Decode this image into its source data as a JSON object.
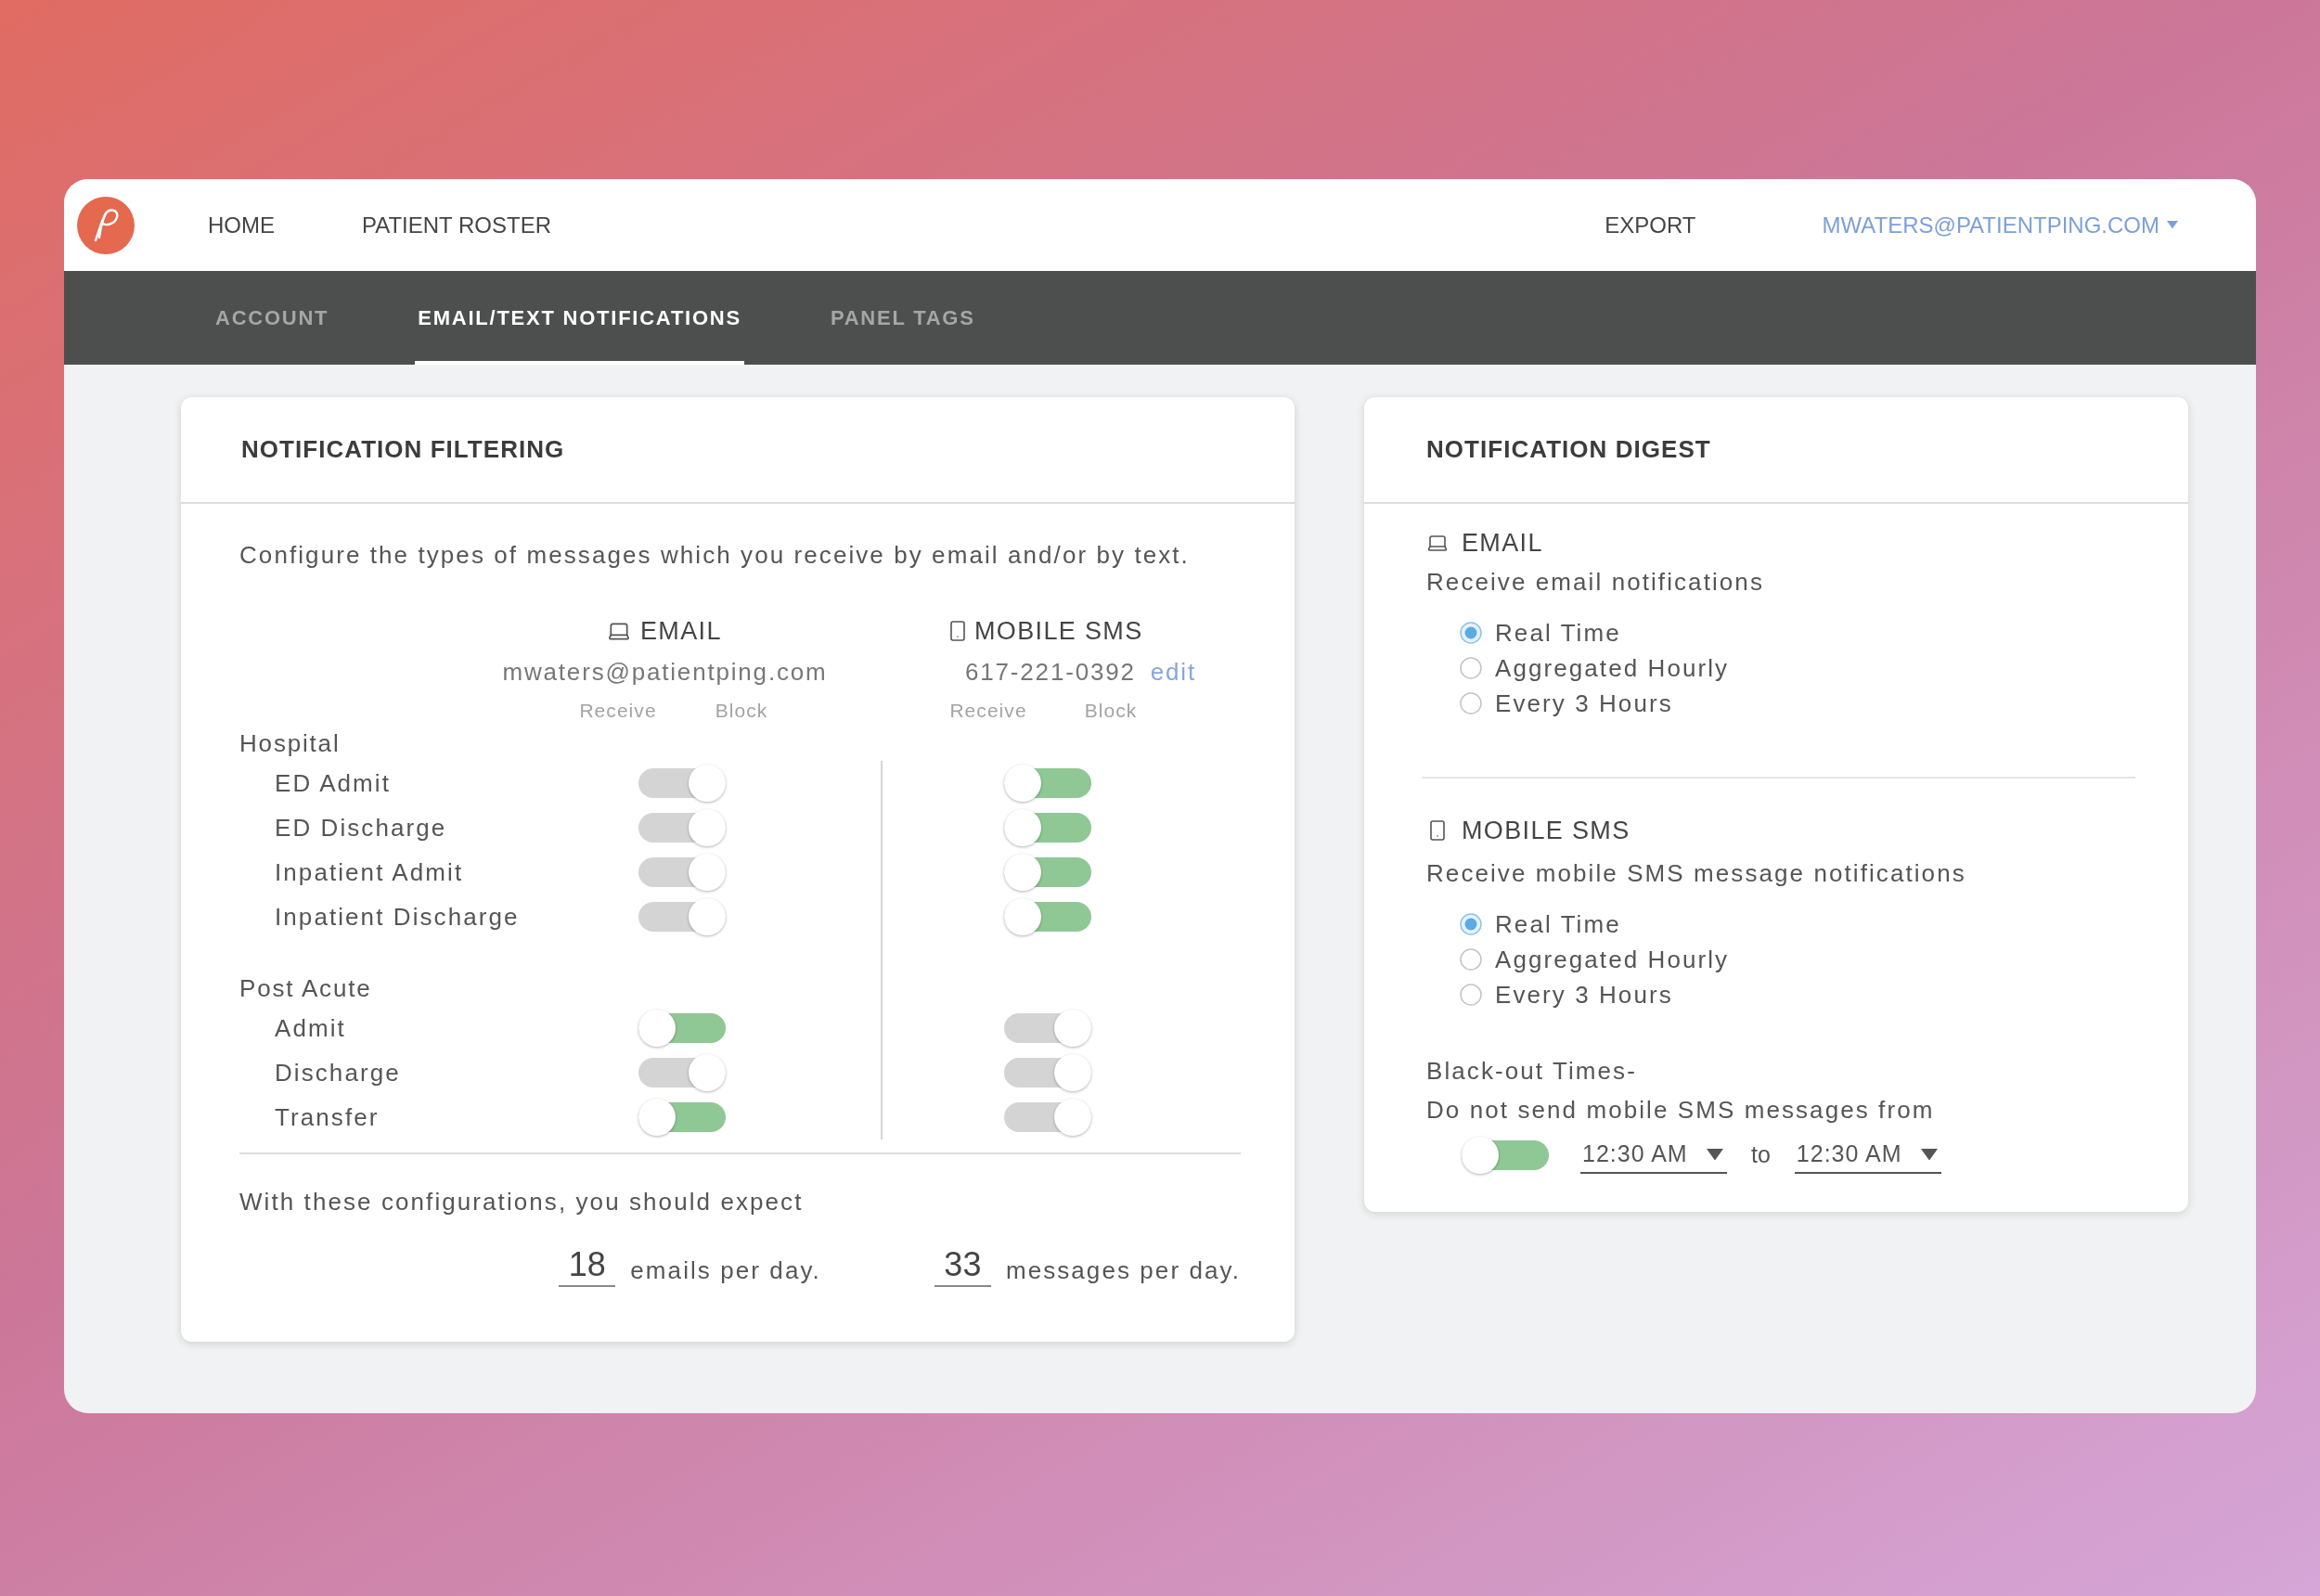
{
  "nav": {
    "links": [
      "HOME",
      "PATIENT ROSTER"
    ],
    "export": "EXPORT",
    "account": "MWATERS@PATIENTPING.COM"
  },
  "tabs": [
    {
      "label": "ACCOUNT",
      "selected": false
    },
    {
      "label": "EMAIL/TEXT NOTIFICATIONS",
      "selected": true
    },
    {
      "label": "PANEL TAGS",
      "selected": false
    }
  ],
  "filtering": {
    "title": "NOTIFICATION FILTERING",
    "description": "Configure the types of messages which you receive by email and/or by text.",
    "channels": [
      {
        "kind": "email",
        "label": "EMAIL",
        "address": "mwaters@patientping.com",
        "receive_label": "Receive",
        "block_label": "Block"
      },
      {
        "kind": "sms",
        "label": "MOBILE SMS",
        "address": "617-221-0392",
        "edit": "edit",
        "receive_label": "Receive",
        "block_label": "Block"
      }
    ],
    "groups": [
      {
        "title": "Hospital",
        "rows": [
          {
            "label": "ED Admit",
            "blocked": [
              true,
              false
            ]
          },
          {
            "label": "ED Discharge",
            "blocked": [
              true,
              false
            ]
          },
          {
            "label": "Inpatient Admit",
            "blocked": [
              true,
              false
            ]
          },
          {
            "label": "Inpatient Discharge",
            "blocked": [
              true,
              false
            ]
          }
        ]
      },
      {
        "title": "Post Acute",
        "rows": [
          {
            "label": "Admit",
            "blocked": [
              false,
              true
            ]
          },
          {
            "label": "Discharge",
            "blocked": [
              true,
              true
            ]
          },
          {
            "label": "Transfer",
            "blocked": [
              false,
              true
            ]
          }
        ]
      }
    ],
    "summary": "With these configurations, you should expect",
    "totals": [
      {
        "count": "18",
        "unit": "emails per day."
      },
      {
        "count": "33",
        "unit": "messages per day."
      }
    ]
  },
  "digest": {
    "title": "NOTIFICATION DIGEST",
    "sections": [
      {
        "kind": "email",
        "label": "EMAIL",
        "description": "Receive email notifications",
        "options": [
          {
            "label": "Real Time",
            "selected": true
          },
          {
            "label": "Aggregated Hourly",
            "selected": false
          },
          {
            "label": "Every 3 Hours",
            "selected": false
          }
        ]
      },
      {
        "kind": "sms",
        "label": "MOBILE SMS",
        "description": "Receive mobile SMS message notifications",
        "options": [
          {
            "label": "Real Time",
            "selected": true
          },
          {
            "label": "Aggregated Hourly",
            "selected": false
          },
          {
            "label": "Every 3 Hours",
            "selected": false
          }
        ]
      }
    ],
    "blackout": {
      "title": "Black-out Times-",
      "description": "Do not send mobile SMS messages from",
      "off": false,
      "from": "12:30 AM",
      "separator": "to",
      "to": "12:30 AM"
    }
  }
}
